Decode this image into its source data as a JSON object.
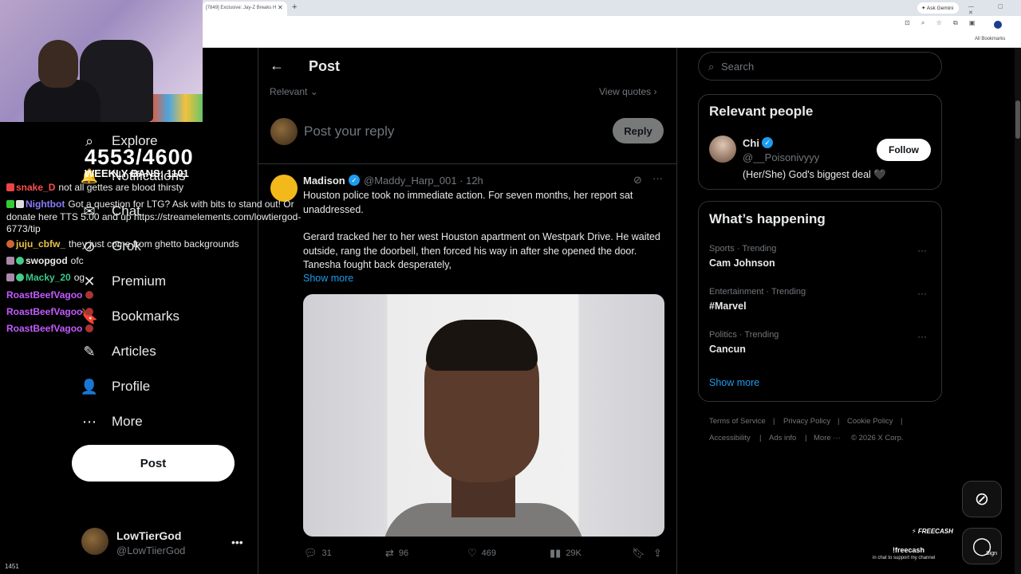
{
  "browser": {
    "tab_title": "[7849] Exclusive: Jay-Z Breaks H",
    "tab_close": "✕",
    "new_tab": "+",
    "ask_gemini": "✦ Ask Gemini",
    "window_controls": "— ▢ ✕",
    "all_bookmarks": "All Bookmarks"
  },
  "overlay": {
    "counter": "4553/4600",
    "weekly_bans": "WEEKLY BANS: 1101",
    "viewer_count": "1451",
    "chat": [
      {
        "user": "snake_D",
        "text": "not all gettes are blood thirsty",
        "color": "#ff4d4d"
      },
      {
        "user": "Nightbot",
        "text": "Got a question for LTG? Ask with bits to stand out! Or donate here TTS 5.00 and up https://streamelements.com/lowtiergod-",
        "color": "#8a7cff"
      },
      {
        "user": "",
        "text": "6773/tip",
        "color": "#e7e9ea"
      },
      {
        "user": "juju_cbfw_",
        "text": "they just come from ghetto backgrounds",
        "color": "#e8c24a"
      },
      {
        "user": "swopgod",
        "text": "ofc",
        "color": "#e7e9ea"
      },
      {
        "user": "Macky_20",
        "text": "og",
        "color": "#38c98a"
      },
      {
        "user": "RoastBeefVagoo",
        "text": "",
        "color": "#c45bff"
      },
      {
        "user": "RoastBeefVagoo",
        "text": "",
        "color": "#c45bff"
      },
      {
        "user": "RoastBeefVagoo",
        "text": "",
        "color": "#c45bff"
      }
    ]
  },
  "nav": {
    "items": [
      {
        "label": "Explore",
        "icon": "⌕"
      },
      {
        "label": "Notifications",
        "icon": "🔔"
      },
      {
        "label": "Chat",
        "icon": "✉"
      },
      {
        "label": "Grok",
        "icon": "⊘"
      },
      {
        "label": "Premium",
        "icon": "✕"
      },
      {
        "label": "Bookmarks",
        "icon": "🔖"
      },
      {
        "label": "Articles",
        "icon": "✎"
      },
      {
        "label": "Profile",
        "icon": "👤"
      },
      {
        "label": "More",
        "icon": "⋯"
      }
    ],
    "post_button": "Post",
    "account": {
      "name": "LowTierGod",
      "handle": "@LowTiierGod",
      "more": "•••"
    }
  },
  "post": {
    "header_title": "Post",
    "back_icon": "←",
    "sort_label": "Relevant ⌄",
    "view_quotes": "View quotes ›",
    "reply_placeholder": "Post your reply",
    "reply_button": "Reply",
    "tweet": {
      "name": "Madison",
      "handle_time": "@Maddy_Harp_001 · 12h",
      "paragraph1": "Houston police took no immediate action. For seven months, her report sat unaddressed.",
      "paragraph2": "Gerard tracked her to her west Houston apartment on Westpark Drive. He waited outside, rang the doorbell, then forced his way in after she opened the door. Tanesha fought back desperately,",
      "show_more": "Show more",
      "replies": "31",
      "reposts": "96",
      "likes": "469",
      "views": "29K"
    }
  },
  "sidebar": {
    "search_placeholder": "Search",
    "relevant_people_title": "Relevant people",
    "person": {
      "name": "Chi",
      "handle": "@__Poisonivyyy",
      "bio": "(Her/She) God's biggest deal 🖤",
      "follow": "Follow"
    },
    "happening_title": "What’s happening",
    "trends": [
      {
        "category": "Sports · Trending",
        "name": "Cam Johnson"
      },
      {
        "category": "Entertainment · Trending",
        "name": "#Marvel"
      },
      {
        "category": "Politics · Trending",
        "name": "Cancun"
      }
    ],
    "show_more": "Show more",
    "footer": [
      "Terms of Service",
      "|",
      "Privacy Policy",
      "|",
      "Cookie Policy",
      "|",
      "Accessibility",
      "|",
      "Ads info",
      "|",
      "More ···",
      "© 2026 X Corp."
    ]
  },
  "freecash": {
    "logo": "⚡ FREECASH",
    "command": "!freecash",
    "subtitle": "in chat to support my channel",
    "sign": "Sign"
  }
}
